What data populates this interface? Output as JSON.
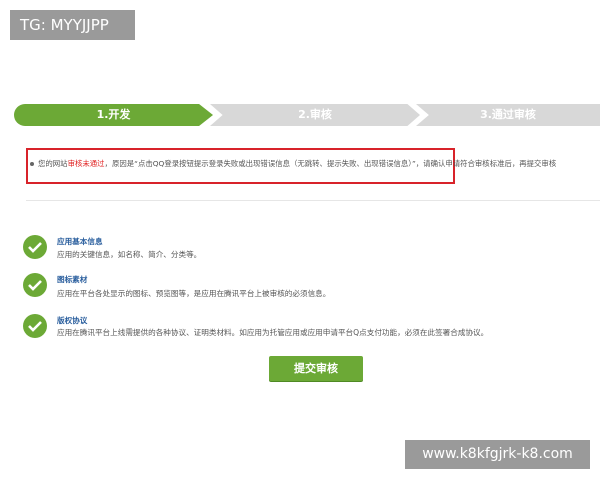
{
  "tg_label": "TG: MYYJJPP",
  "steps": [
    {
      "label": "1.开发"
    },
    {
      "label": "2.审核"
    },
    {
      "label": "3.通过审核"
    }
  ],
  "notice": {
    "prefix": "您的网站",
    "status": "审核未通过",
    "reason": "，原因是“点击QQ登录按钮提示登录失败或出现错误信息（无跳转、提示失败、出现错误信息）”",
    "suffix": "，请确认申请符合审核标准后，再提交审核"
  },
  "items": [
    {
      "title": "应用基本信息",
      "desc": "应用的关键信息，如名称、简介、分类等。"
    },
    {
      "title": "图标素材",
      "desc": "应用在平台各处显示的图标、预览图等，是应用在腾讯平台上被审核的必须信息。"
    },
    {
      "title": "版权协议",
      "desc": "应用在腾讯平台上线需提供的各种协议、证明类材料。如应用为托管应用或应用申请平台Q点支付功能，必须在此签署合成协议。"
    }
  ],
  "submit_label": "提交审核",
  "watermark": "www.k8kfgjrk-k8.com",
  "colors": {
    "accent_green": "#6ca936",
    "alert_red": "#d8232a",
    "link_blue": "#2b5f9e"
  }
}
